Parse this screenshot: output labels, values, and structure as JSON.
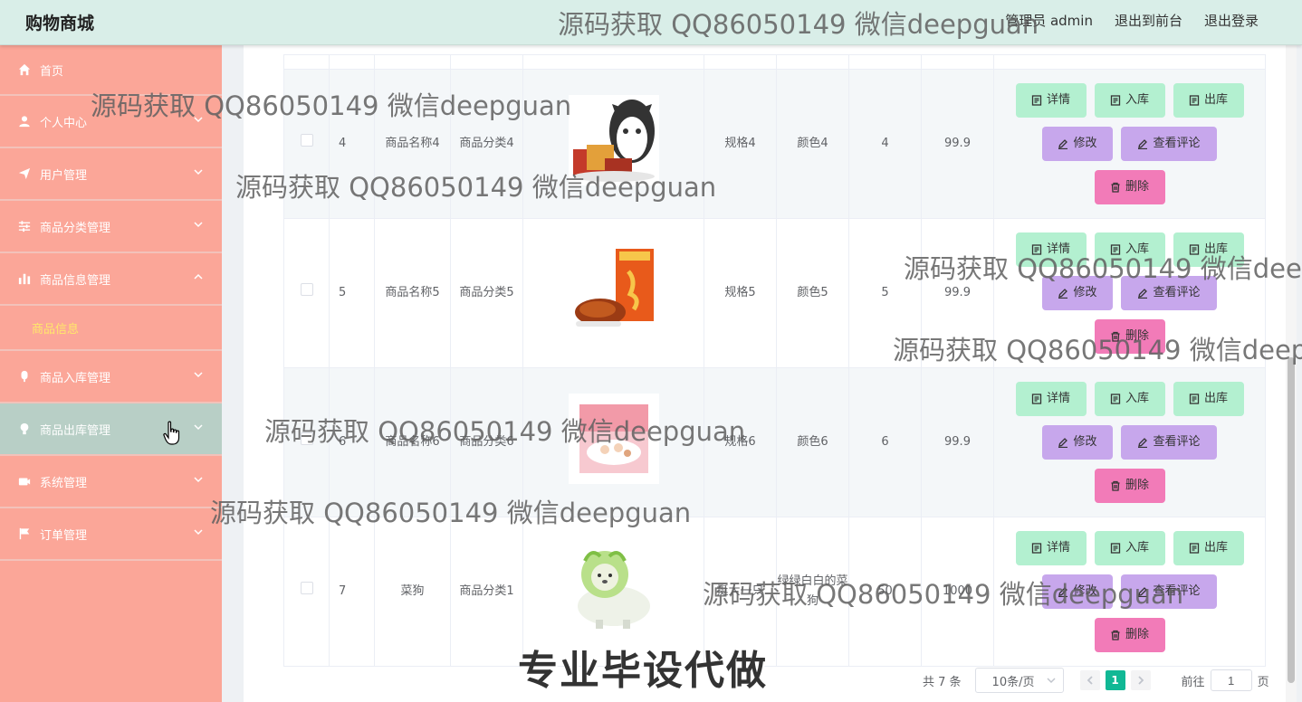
{
  "header": {
    "brand": "购物商城",
    "user_label": "管理员 admin",
    "to_front": "退出到前台",
    "logout": "退出登录"
  },
  "sidebar": {
    "items": [
      {
        "label": "首页",
        "icon": "home-icon"
      },
      {
        "label": "个人中心",
        "icon": "user-icon"
      },
      {
        "label": "用户管理",
        "icon": "send-icon"
      },
      {
        "label": "商品分类管理",
        "icon": "sliders-icon"
      },
      {
        "label": "商品信息管理",
        "icon": "bar-chart-icon"
      },
      {
        "label": "商品入库管理",
        "icon": "microphone-icon"
      },
      {
        "label": "商品出库管理",
        "icon": "bulb-icon"
      },
      {
        "label": "系统管理",
        "icon": "camera-icon"
      },
      {
        "label": "订单管理",
        "icon": "flag-icon"
      }
    ],
    "sub_active": "商品信息"
  },
  "table": {
    "rows": [
      {
        "id": "4",
        "name": "商品名称4",
        "category": "商品分类4",
        "spec": "规格4",
        "color": "颜色4",
        "qty": "4",
        "price": "99.9"
      },
      {
        "id": "5",
        "name": "商品名称5",
        "category": "商品分类5",
        "spec": "规格5",
        "color": "颜色5",
        "qty": "5",
        "price": "99.9"
      },
      {
        "id": "6",
        "name": "商品名称6",
        "category": "商品分类6",
        "spec": "规格6",
        "color": "颜色6",
        "qty": "6",
        "price": "99.9"
      },
      {
        "id": "7",
        "name": "菜狗",
        "category": "商品分类1",
        "spec": "挺大一只",
        "color": "绿绿白白的菜狗",
        "qty": "50",
        "price": "1000"
      }
    ],
    "buttons": {
      "detail": "详情",
      "stock_in": "入库",
      "stock_out": "出库",
      "edit": "修改",
      "comments": "查看评论",
      "delete": "删除"
    }
  },
  "pagination": {
    "total": "共 7 条",
    "page_size": "10条/页",
    "current": "1",
    "goto_label": "前往",
    "goto_value": "1",
    "goto_suffix": "页"
  },
  "watermark": {
    "text": "源码获取 QQ86050149 微信deepguan",
    "big": "专业毕设代做"
  },
  "colors": {
    "header_bg": "#d9eee8",
    "sidebar_bg": "#fba698",
    "sidebar_active": "#b8cfc6",
    "btn_green": "#b3f0d0",
    "btn_purple": "#c7a7ec",
    "btn_pink": "#f27bb8",
    "page_active": "#11b895"
  }
}
